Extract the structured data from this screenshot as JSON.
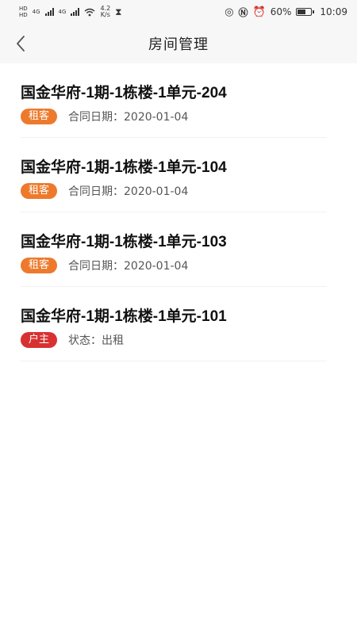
{
  "status_bar": {
    "hd_label": "HD",
    "sim1": "4G",
    "sim2": "4G",
    "net_speed_value": "4.2",
    "net_speed_unit": "K/s",
    "battery_percent": "60%",
    "time": "10:09"
  },
  "header": {
    "title": "房间管理"
  },
  "rooms": [
    {
      "title": "国金华府-1期-1栋楼-1单元-204",
      "tag": "租客",
      "tag_color": "#ed7a2c",
      "detail": "合同日期：2020-01-04"
    },
    {
      "title": "国金华府-1期-1栋楼-1单元-104",
      "tag": "租客",
      "tag_color": "#ed7a2c",
      "detail": "合同日期：2020-01-04"
    },
    {
      "title": "国金华府-1期-1栋楼-1单元-103",
      "tag": "租客",
      "tag_color": "#ed7a2c",
      "detail": "合同日期：2020-01-04"
    },
    {
      "title": "国金华府-1期-1栋楼-1单元-101",
      "tag": "户主",
      "tag_color": "#d83131",
      "detail": "状态：出租"
    }
  ]
}
